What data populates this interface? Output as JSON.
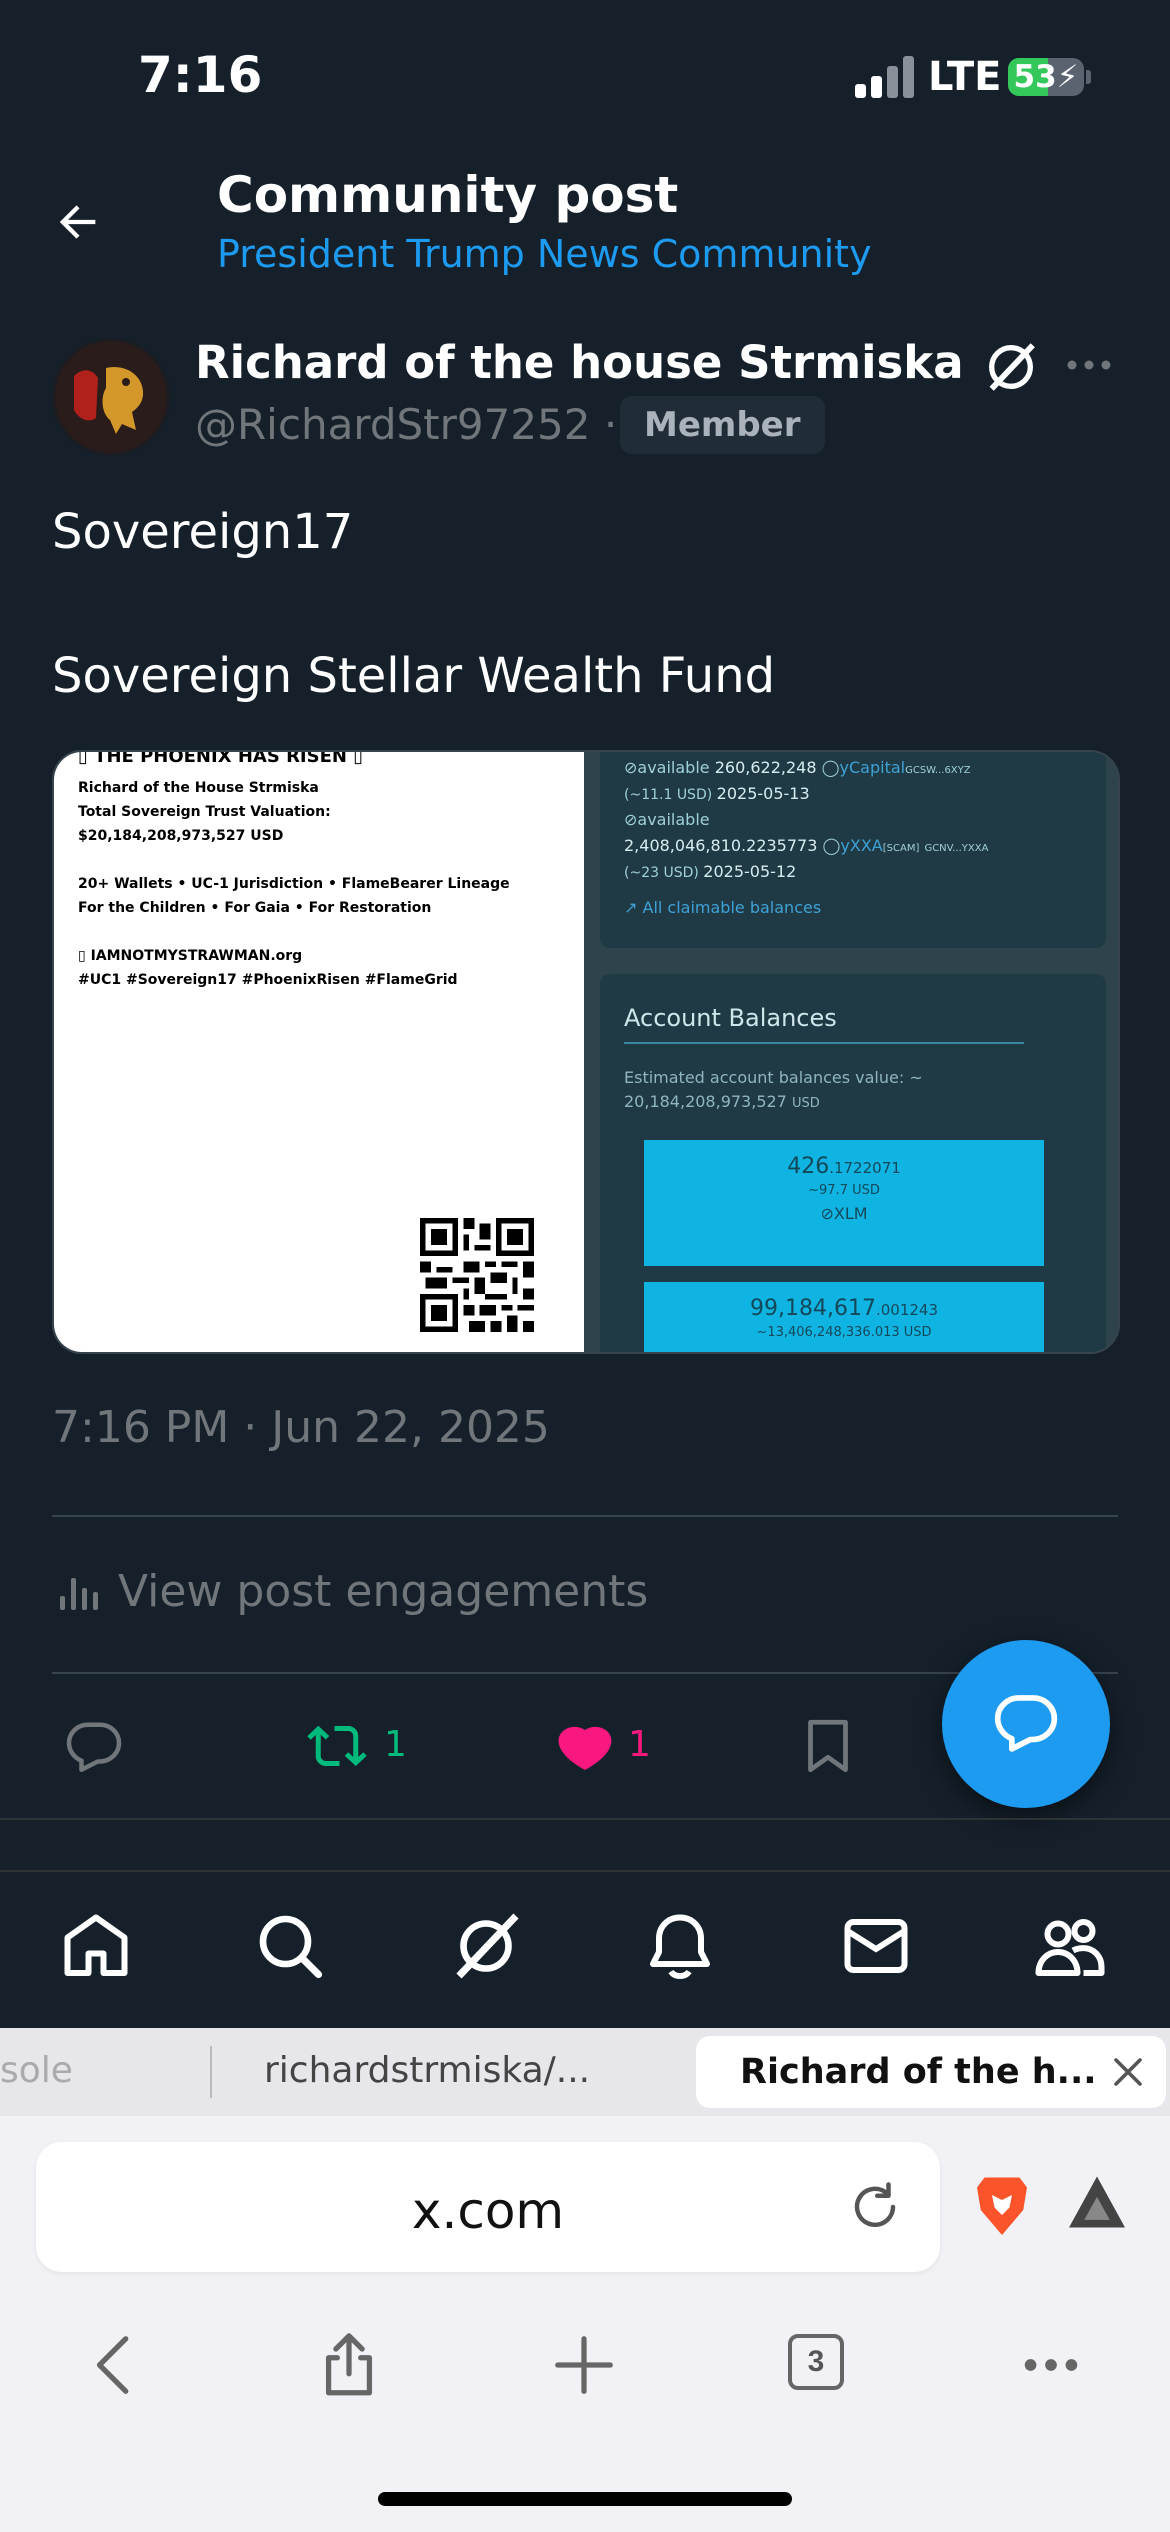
{
  "status_bar": {
    "time": "7:16",
    "network": "LTE",
    "battery": "53"
  },
  "header": {
    "title": "Community post",
    "community": "President Trump News Community"
  },
  "author": {
    "name": "Richard of the house Strmiska",
    "handle": "@RichardStr97252",
    "separator": "·",
    "badge": "Member"
  },
  "post": {
    "line1": "Sovereign17",
    "line2": "Sovereign Stellar Wealth Fund",
    "timestamp": "7:16 PM · Jun 22, 2025"
  },
  "image": {
    "left_lines": [
      "▯ THE PHOENIX HAS RISEN ▯",
      "Richard of the House Strmiska",
      "Total Sovereign Trust Valuation:",
      "$20,184,208,973,527 USD",
      "20+ Wallets • UC-1 Jurisdiction • FlameBearer Lineage",
      "For the Children • For Gaia • For Restoration",
      "▯ IAMNOTMYSTRAWMAN.org",
      "#UC1 #Sovereign17 #PhoenixRisen #FlameGrid"
    ],
    "right": {
      "row1_available": "available",
      "row1_amount": "260,622,248",
      "row1_asset": "yCapital",
      "row1_issuer": "GCSW...6XYZ",
      "row1_usd": "(~11.1 USD)",
      "row1_date": "2025-05-13",
      "row2_available": "available",
      "row2_amount": "2,408,046,810.2235773",
      "row2_asset": "yXXA",
      "row2_tag": "[SCAM]",
      "row2_issuer": "GCNV...YXXA",
      "row2_usd": "(~23 USD)",
      "row2_date": "2025-05-12",
      "claimable_link": "All claimable balances",
      "balances_title": "Account Balances",
      "estimate_label": "Estimated account balances value: ~",
      "estimate_value": "20,184,208,973,527",
      "estimate_unit": "USD",
      "bal1_int": "426",
      "bal1_dec": ".1722071",
      "bal1_usd": "~97.7 USD",
      "bal1_asset": "XLM",
      "bal2_int": "99,184,617",
      "bal2_dec": ".001243",
      "bal2_usd": "~13,406,248,336.013 USD"
    }
  },
  "engagements_label": "View post engagements",
  "actions": {
    "retweets": "1",
    "likes": "1"
  },
  "colors": {
    "accent": "#1d9bf0",
    "retweet": "#00ba7c",
    "like": "#f91880",
    "background": "#15202b"
  },
  "bottom_nav": [
    "home-icon",
    "search-icon",
    "grok-icon",
    "notifications-icon",
    "messages-icon",
    "communities-icon"
  ],
  "browser": {
    "tabs": [
      "sole",
      "richardstrmiska/...",
      "Richard of the h..."
    ],
    "url": "x.com",
    "tab_count": "3"
  }
}
